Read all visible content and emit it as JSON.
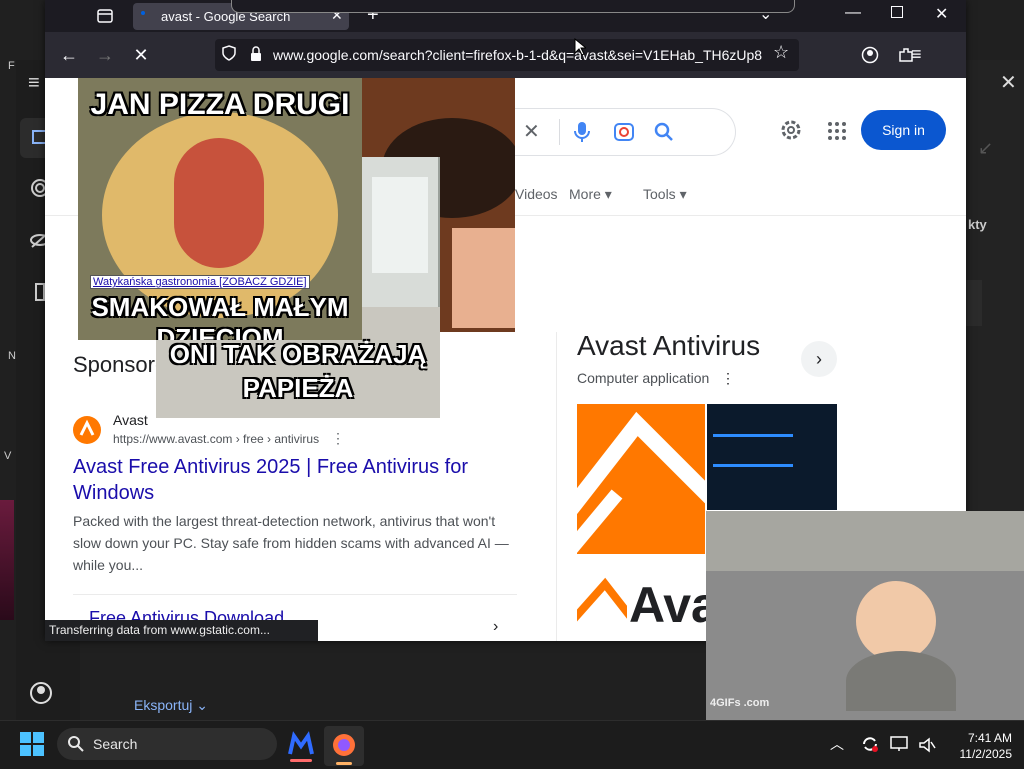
{
  "browser": {
    "tab_title": "avast - Google Search",
    "url": "www.google.com/search?client=firefox-b-1-d&q=avast&sei=V1EHab_TH6zUp8",
    "status_text": "Transferring data from www.gstatic.com..."
  },
  "google": {
    "sign_in": "Sign in",
    "tabs": {
      "videos": "Videos",
      "more": "More",
      "tools": "Tools"
    },
    "sponsored": "Sponsored",
    "result": {
      "site": "Avast",
      "url": "https://www.avast.com › free › antivirus",
      "title": "Avast Free Antivirus 2025 | Free Antivirus for Windows",
      "snippet": "Packed with the largest threat-detection network, antivirus that won't slow down your PC. Stay safe from hidden scams with advanced AI —while you...",
      "sitelink": "Free Antivirus Download"
    },
    "knowledge_panel": {
      "title": "Avast Antivirus",
      "subtitle": "Computer application",
      "logo_text": "Avast"
    }
  },
  "overlay_meme1": {
    "top_text": "JAN PIZZA DRUGI",
    "caption_link": "Watykańska gastronomia [ZOBACZ GDZIE]",
    "bottom_text": "SMAKOWAŁ MAŁYM DZIECIOM"
  },
  "overlay_meme2": {
    "text_line1": "ONI TAK OBRAŻAJĄ",
    "text_line2": "PAPIEŻA"
  },
  "overlay_gif": {
    "watermark": "4GIFs .com"
  },
  "background_app": {
    "export_label": "Eksportuj",
    "side_text": "kty"
  },
  "taskbar": {
    "search_label": "Search",
    "time": "7:41 AM",
    "date": "11/2/2025"
  },
  "colors": {
    "google_blue": "#0b57d0",
    "link": "#1a0dab",
    "avast_orange": "#ff7800"
  }
}
